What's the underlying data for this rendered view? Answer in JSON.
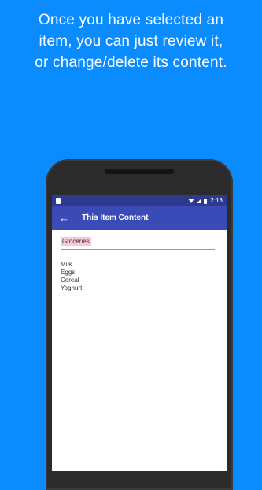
{
  "headline": {
    "line1": "Once you have selected an",
    "line2": "item, you can just review it,",
    "line3": "or change/delete its content."
  },
  "status_bar": {
    "time": "2:18",
    "icons": [
      "notification-icon",
      "wifi-icon",
      "signal-icon",
      "battery-icon"
    ]
  },
  "app_bar": {
    "back_icon": "←",
    "title": "This Item Content"
  },
  "item": {
    "name": "Groceries",
    "content": "Milk\nEggs\nCereal\nYoghurt"
  },
  "colors": {
    "background": "#0a8cff",
    "status_bar": "#2d3a8e",
    "app_bar": "#3a4bb7",
    "field_underline": "#e57399",
    "selection_highlight": "#f7c9d8"
  }
}
